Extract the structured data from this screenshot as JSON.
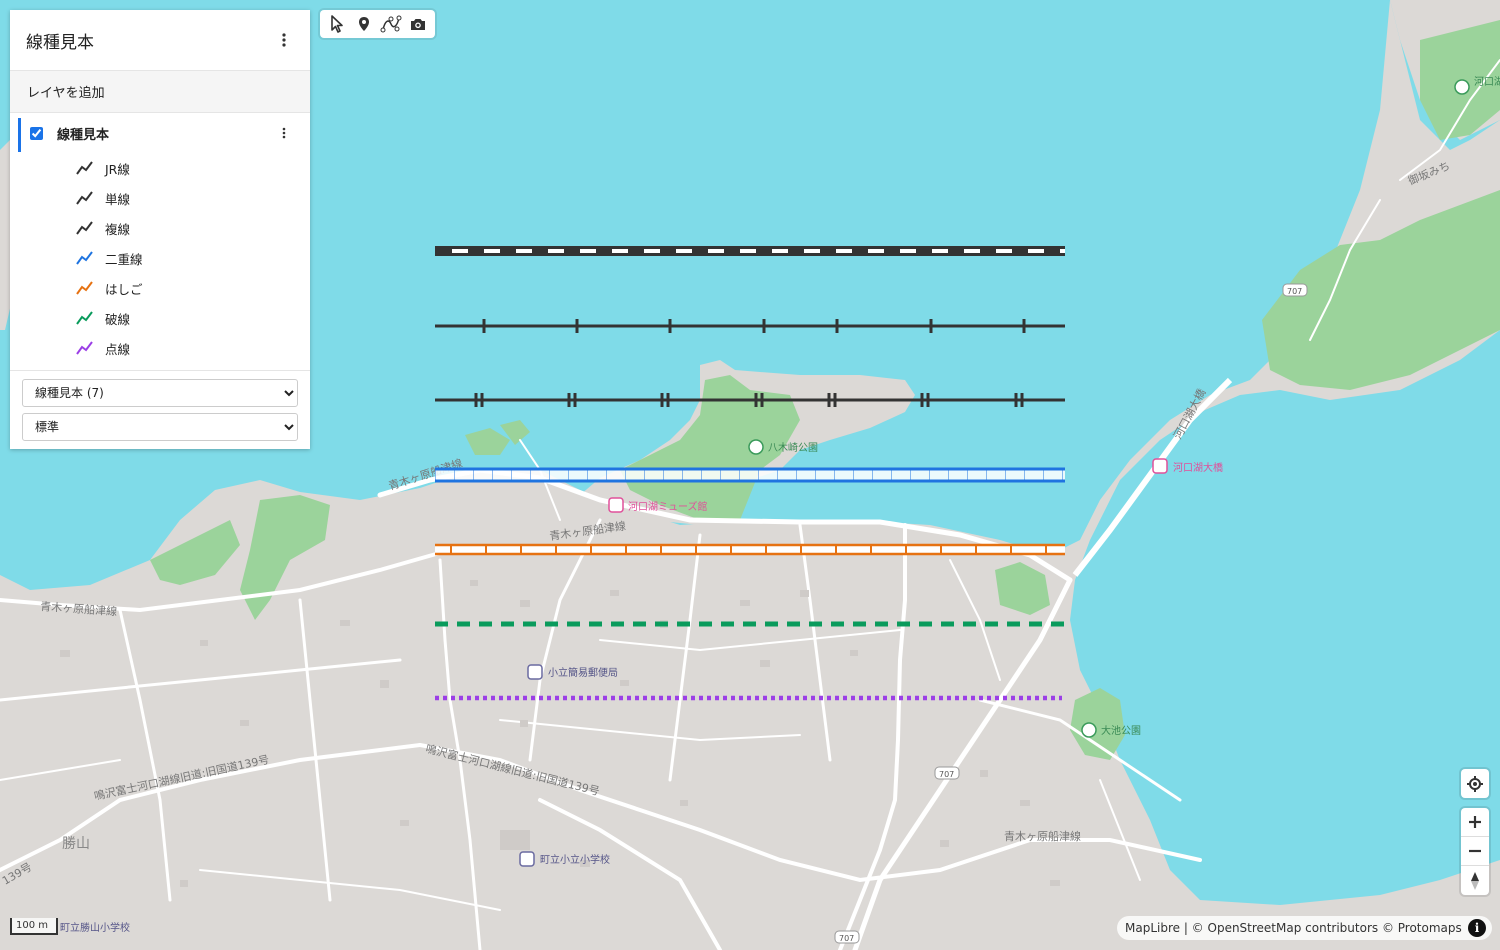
{
  "panel": {
    "title": "線種見本",
    "add_layer_label": "レイヤを追加",
    "layer": {
      "name": "線種見本",
      "checked": true,
      "sublayers": [
        {
          "label": "JR線",
          "color": "#333333"
        },
        {
          "label": "単線",
          "color": "#333333"
        },
        {
          "label": "複線",
          "color": "#333333"
        },
        {
          "label": "二重線",
          "color": "#1f74e0"
        },
        {
          "label": "はしご",
          "color": "#e67212"
        },
        {
          "label": "破線",
          "color": "#0a9b5c"
        },
        {
          "label": "点線",
          "color": "#9b3fe6"
        }
      ]
    },
    "select_layer": {
      "selected": "線種見本 (7)"
    },
    "select_style": {
      "selected": "標準"
    }
  },
  "toolbar": {
    "tools": [
      "pointer-icon",
      "marker-icon",
      "line-draw-icon",
      "camera-icon"
    ]
  },
  "map": {
    "labels": {
      "poi_yagisaki_park": "八木崎公園",
      "poi_museum": "河口湖ミューズ館",
      "poi_bridge": "河口湖大橋",
      "poi_post_office": "小立簡易郵便局",
      "poi_oike_park": "大池公園",
      "poi_school": "町立小立小学校",
      "poi_school2": "町立勝山小学校",
      "poi_art": "河口湖",
      "road_aokigahara_1": "青木ヶ原船津線",
      "road_aokigahara_2": "青木ヶ原船津線",
      "road_aokigahara_3": "青木ヶ原船津線",
      "road_aokigahara_4": "青木ヶ原船津線",
      "road_narusawa": "鳴沢富士河口湖線旧道:旧国道139号",
      "road_narusawa_2": "鳴沢富士河口湖線旧道:旧国道139号",
      "road_misaka": "御坂みち",
      "road_ohashi": "河口湖大橋",
      "place_katsuyama": "勝山",
      "shield_707": "707",
      "road_139": "139号"
    },
    "colors": {
      "water": "#7fdbe8",
      "land": "#dcd9d6",
      "park": "#9bd39b",
      "road": "#ffffff"
    }
  },
  "scale_label": "100 m",
  "attribution": "MapLibre | © OpenStreetMap contributors © Protomaps"
}
